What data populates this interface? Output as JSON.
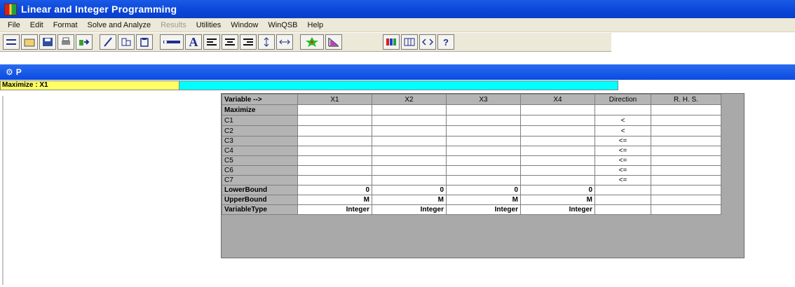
{
  "window": {
    "title": "Linear and Integer Programming"
  },
  "menu": [
    "File",
    "Edit",
    "Format",
    "Solve and Analyze",
    "Results",
    "Utilities",
    "Window",
    "WinQSB",
    "Help"
  ],
  "menu_disabled": [
    "Results"
  ],
  "toolbar": {
    "buttons": [
      "new-icon",
      "open-icon",
      "save-icon",
      "print-icon",
      "copy-icon",
      "edit-icon",
      "cut-icon",
      "paste-icon",
      "font-icon",
      "letter-a-icon",
      "align-left-icon",
      "align-center-icon",
      "align-right-icon",
      "column-width-icon",
      "row-height-icon",
      "solve-icon",
      "graph-icon",
      "color-icon",
      "grid-icon",
      "dual-icon",
      "help-icon"
    ]
  },
  "child_window": {
    "title": "P"
  },
  "cell_bar": {
    "reference": "Maximize : X1",
    "content": ""
  },
  "table": {
    "header": [
      "Variable -->",
      "X1",
      "X2",
      "X3",
      "X4",
      "Direction",
      "R. H. S."
    ],
    "rows": [
      {
        "label": "Maximize",
        "cells": [
          "",
          "",
          "",
          ""
        ],
        "direction": "",
        "rhs": ""
      },
      {
        "label": "C1",
        "cells": [
          "",
          "",
          "",
          ""
        ],
        "direction": "<",
        "rhs": ""
      },
      {
        "label": "C2",
        "cells": [
          "",
          "",
          "",
          ""
        ],
        "direction": "<",
        "rhs": ""
      },
      {
        "label": "C3",
        "cells": [
          "",
          "",
          "",
          ""
        ],
        "direction": "<=",
        "rhs": ""
      },
      {
        "label": "C4",
        "cells": [
          "",
          "",
          "",
          ""
        ],
        "direction": "<=",
        "rhs": ""
      },
      {
        "label": "C5",
        "cells": [
          "",
          "",
          "",
          ""
        ],
        "direction": "<=",
        "rhs": ""
      },
      {
        "label": "C6",
        "cells": [
          "",
          "",
          "",
          ""
        ],
        "direction": "<=",
        "rhs": ""
      },
      {
        "label": "C7",
        "cells": [
          "",
          "",
          "",
          ""
        ],
        "direction": "<=",
        "rhs": ""
      }
    ],
    "lower_bound": {
      "label": "LowerBound",
      "values": [
        "0",
        "0",
        "0",
        "0"
      ]
    },
    "upper_bound": {
      "label": "UpperBound",
      "values": [
        "M",
        "M",
        "M",
        "M"
      ]
    },
    "variable_type": {
      "label": "VariableType",
      "values": [
        "Integer",
        "Integer",
        "Integer",
        "Integer"
      ]
    }
  },
  "colors": {
    "title_bar": "#0a46d8",
    "cell_ref_bg": "#ffff66",
    "cell_edit_bg": "#00ffff",
    "sheet_bg": "#a9a9a9",
    "header_bg": "#b4b4b4"
  }
}
